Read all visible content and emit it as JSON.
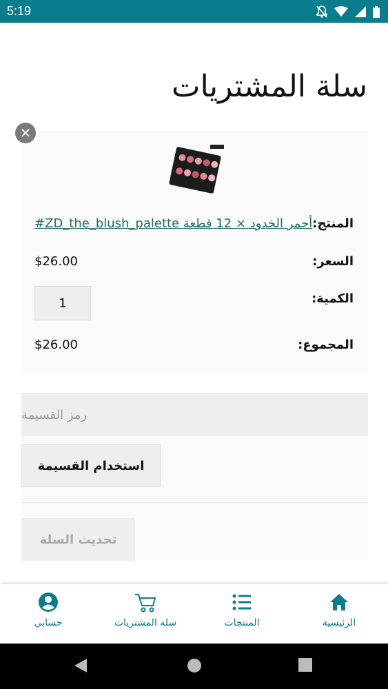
{
  "status_bar": {
    "time": "5:19"
  },
  "page": {
    "title": "سلة المشتريات"
  },
  "cart_item": {
    "product_label": "المنتج:",
    "product_name": "#ZD_the_blush_palette أحمر الخدود × 12 قطعة",
    "price_label": "السعر:",
    "price": "$26.00",
    "quantity_label": "الكمية:",
    "quantity": "1",
    "total_label": "المجموع:",
    "total": "$26.00"
  },
  "coupon": {
    "placeholder": "رمز القسيمة",
    "apply_label": "استخدام القسيمة"
  },
  "update_cart_label": "تحديث السلة",
  "bottom_nav": {
    "home": "الرئيسية",
    "products": "المنتجات",
    "cart": "سلة المشتريات",
    "account": "حسابي"
  },
  "colors": {
    "accent": "#0a7d8c",
    "link": "#1f6f63"
  }
}
